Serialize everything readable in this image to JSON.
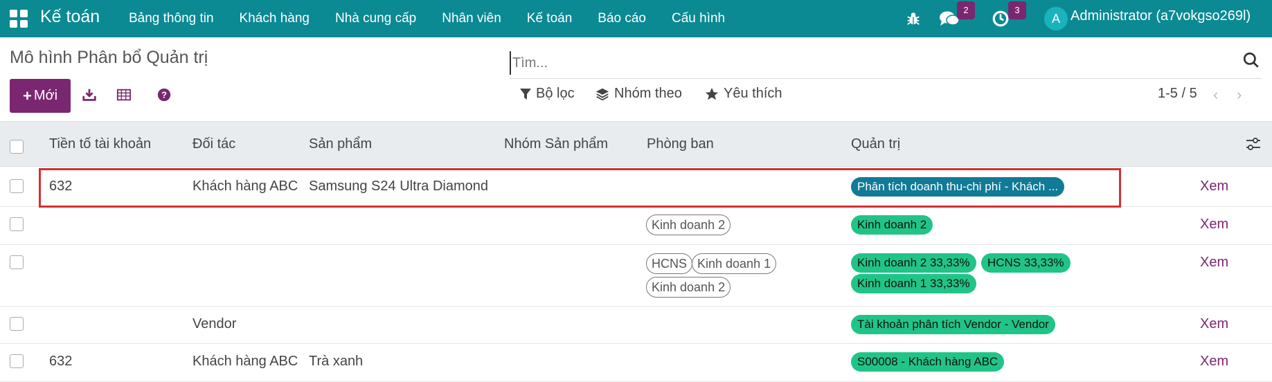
{
  "navbar": {
    "app_name": "Kế toán",
    "menu": [
      "Bảng thông tin",
      "Khách hàng",
      "Nhà cung cấp",
      "Nhân viên",
      "Kế toán",
      "Báo cáo",
      "Cấu hình"
    ],
    "messages_count": "2",
    "activities_count": "3",
    "avatar_letter": "A",
    "user": "Administrator (a7vokgso269l)",
    "icons": [
      "apps-grid-icon",
      "bug-icon",
      "chat-icon",
      "clock-icon"
    ]
  },
  "control": {
    "title": "Mô hình Phân bổ Quản trị",
    "new_label": "Mới",
    "search_placeholder": "Tìm...",
    "filter_label": "Bộ lọc",
    "group_label": "Nhóm theo",
    "favorite_label": "Yêu thích",
    "pager": "1-5 / 5"
  },
  "table": {
    "columns": [
      "Tiền tố tài khoản",
      "Đối tác",
      "Sản phẩm",
      "Nhóm Sản phẩm",
      "Phòng ban",
      "Quản trị"
    ],
    "view_label": "Xem",
    "rows": [
      {
        "prefix": "632",
        "partner": "Khách hàng ABC",
        "product": "Samsung S24 Ultra Diamond",
        "departments": [],
        "analytic": [
          "Phân tích doanh thu-chi phí - Khách ..."
        ]
      },
      {
        "prefix": "",
        "partner": "",
        "product": "",
        "departments": [
          "Kinh doanh 2"
        ],
        "analytic": [
          "Kinh doanh 2"
        ]
      },
      {
        "prefix": "",
        "partner": "",
        "product": "",
        "departments": [
          "HCNS",
          "Kinh doanh 1",
          "Kinh doanh 2"
        ],
        "analytic": [
          "Kinh doanh 2 33,33%",
          "HCNS 33,33%",
          "Kinh doanh 1 33,33%"
        ]
      },
      {
        "prefix": "",
        "partner": "Vendor",
        "product": "",
        "departments": [],
        "analytic": [
          "Tài khoản phân tích Vendor - Vendor"
        ]
      },
      {
        "prefix": "632",
        "partner": "Khách hàng ABC",
        "product": "Trà xanh",
        "departments": [],
        "analytic": [
          "S00008 - Khách hàng ABC"
        ]
      }
    ]
  },
  "colors": {
    "navbar": "#0b8a93",
    "primary": "#7b2670",
    "tag_green": "#21c487",
    "tag_blue": "#117a96",
    "highlight": "#d32f2f"
  }
}
